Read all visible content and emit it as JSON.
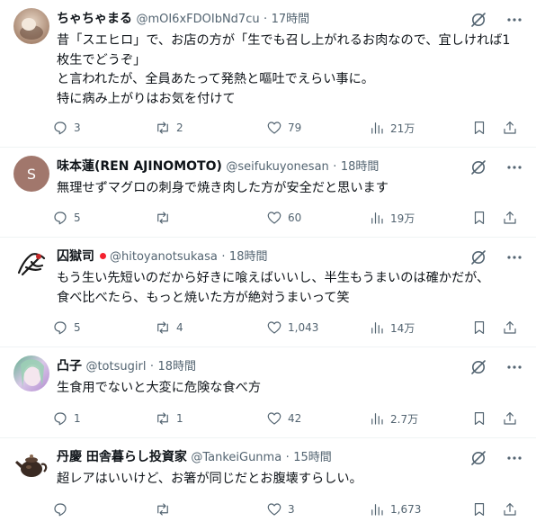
{
  "posts": [
    {
      "name": "ちゃちゃまる",
      "handle": "@mOI6xFDOIbNd7cu",
      "separator": "·",
      "time": "17時間",
      "text": "昔「スエヒロ」で、お店の方が「生でも召し上がれるお肉なので、宜しければ1枚生でどうぞ」\nと言われたが、全員あたって発熱と嘔吐でえらい事に。\n特に病み上がりはお気を付けて",
      "replies": "3",
      "reposts": "2",
      "likes": "79",
      "views": "21万",
      "avatar": {
        "type": "photo",
        "colors": [
          "#b59a86",
          "#e8d7c6",
          "#6b4f3f"
        ]
      }
    },
    {
      "name": "味本蓮(REN AJINOMOTO)",
      "handle": "@seifukuyonesan",
      "separator": "·",
      "time": "18時間",
      "text": "無理せずマグロの刺身で焼き肉した方が安全だと思います",
      "replies": "5",
      "reposts": "",
      "likes": "60",
      "views": "19万",
      "avatar": {
        "type": "letter",
        "letter": "S",
        "colors": [
          "#a1776c"
        ]
      }
    },
    {
      "name": "囚獄司",
      "handle": "@hitoyanotsukasa",
      "separator": "·",
      "time": "18時間",
      "text": "もう生い先短いのだから好きに喰えばいいし、半生もうまいのは確かだが、\n食べ比べたら、もっと焼いた方が絶対うまいって笑",
      "replies": "5",
      "reposts": "4",
      "likes": "1,043",
      "views": "14万",
      "avatar": {
        "type": "sketch",
        "colors": [
          "#ffffff",
          "#1a1a1a",
          "#c62828"
        ]
      }
    },
    {
      "name": "凸子",
      "handle": "@totsugirl",
      "separator": "·",
      "time": "18時間",
      "text": "生食用でないと大変に危険な食べ方",
      "replies": "1",
      "reposts": "1",
      "likes": "42",
      "views": "2.7万",
      "avatar": {
        "type": "photo",
        "colors": [
          "#5fb08a",
          "#d9c8e8",
          "#b28bd0"
        ]
      }
    },
    {
      "name": "丹慶 田舎暮らし投資家",
      "handle": "@TankeiGunma",
      "separator": "·",
      "time": "15時間",
      "text": "超レアはいいけど、お箸が同じだとお腹壊すらしい。",
      "replies": "",
      "reposts": "",
      "likes": "3",
      "views": "1,673",
      "avatar": {
        "type": "teapot",
        "colors": [
          "#ffffff",
          "#3a2a22",
          "#8a6a52"
        ]
      }
    }
  ],
  "icons": {
    "reply": "reply-icon",
    "repost": "repost-icon",
    "like": "like-icon",
    "views": "views-icon",
    "bookmark": "bookmark-icon",
    "share": "share-icon",
    "grok": "grok-icon",
    "more": "more-icon"
  },
  "colors": {
    "text": "#0f1419",
    "secondary": "#536471",
    "divider": "#eff3f4",
    "badge": "#f4212e"
  }
}
